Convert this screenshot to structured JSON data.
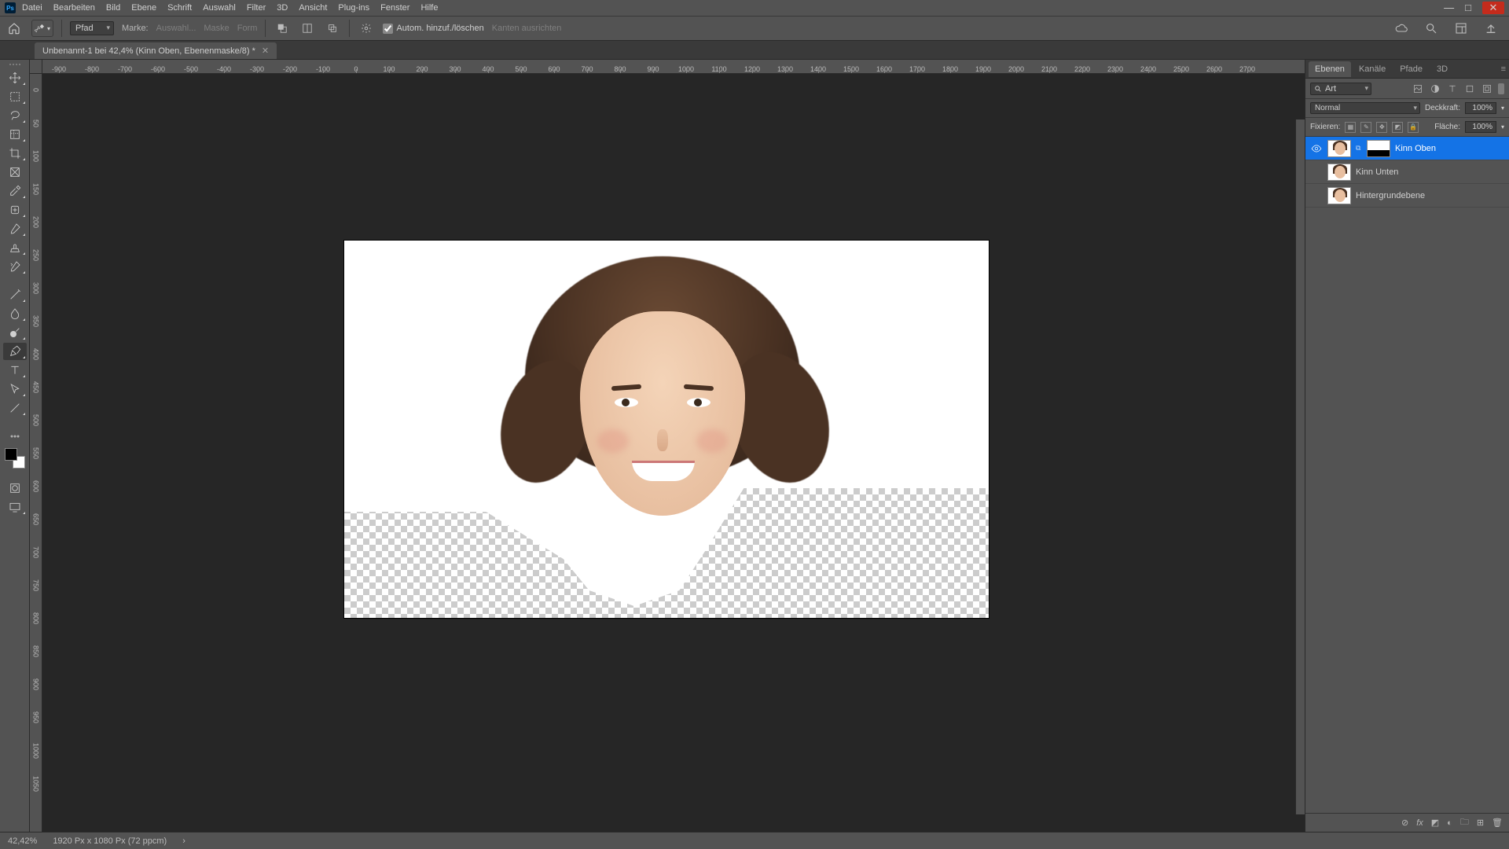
{
  "app_logo": "Ps",
  "menu": [
    "Datei",
    "Bearbeiten",
    "Bild",
    "Ebene",
    "Schrift",
    "Auswahl",
    "Filter",
    "3D",
    "Ansicht",
    "Plug-ins",
    "Fenster",
    "Hilfe"
  ],
  "window_controls": [
    "—",
    "□",
    "✕"
  ],
  "options": {
    "mode_label": "Pfad",
    "marke": "Marke:",
    "auswahl": "Auswahl...",
    "maske": "Maske",
    "form": "Form",
    "auto_label": "Autom. hinzuf./löschen",
    "kanten": "Kanten ausrichten"
  },
  "document_tab": "Unbenannt-1 bei 42,4% (Kinn Oben, Ebenenmaske/8) *",
  "ruler_h": [
    "-900",
    "-800",
    "-700",
    "-600",
    "-500",
    "-400",
    "-300",
    "-200",
    "-100",
    "0",
    "100",
    "200",
    "300",
    "400",
    "500",
    "600",
    "700",
    "800",
    "900",
    "1000",
    "1100",
    "1200",
    "1300",
    "1400",
    "1500",
    "1600",
    "1700",
    "1800",
    "1900",
    "2000",
    "2100",
    "2200",
    "2300",
    "2400",
    "2500",
    "2600",
    "2700"
  ],
  "ruler_v": [
    "0",
    "50",
    "100",
    "150",
    "200",
    "250",
    "300",
    "350",
    "400",
    "450",
    "500",
    "550",
    "600",
    "650",
    "700",
    "750",
    "800",
    "850",
    "900",
    "950",
    "1000",
    "1050"
  ],
  "panel_tabs": [
    "Ebenen",
    "Kanäle",
    "Pfade",
    "3D"
  ],
  "layers_panel": {
    "search_label": "Art",
    "blend_mode": "Normal",
    "opacity_label": "Deckkraft:",
    "opacity_value": "100%",
    "lock_label": "Fixieren:",
    "fill_label": "Fläche:",
    "fill_value": "100%"
  },
  "layers": [
    {
      "name": "Kinn Oben",
      "visible": true,
      "has_mask": true,
      "selected": true
    },
    {
      "name": "Kinn Unten",
      "visible": false,
      "has_mask": false,
      "selected": false
    },
    {
      "name": "Hintergrundebene",
      "visible": false,
      "has_mask": false,
      "selected": false
    }
  ],
  "status": {
    "zoom": "42,42%",
    "doc_info": "1920 Px x 1080 Px (72 ppcm)"
  }
}
